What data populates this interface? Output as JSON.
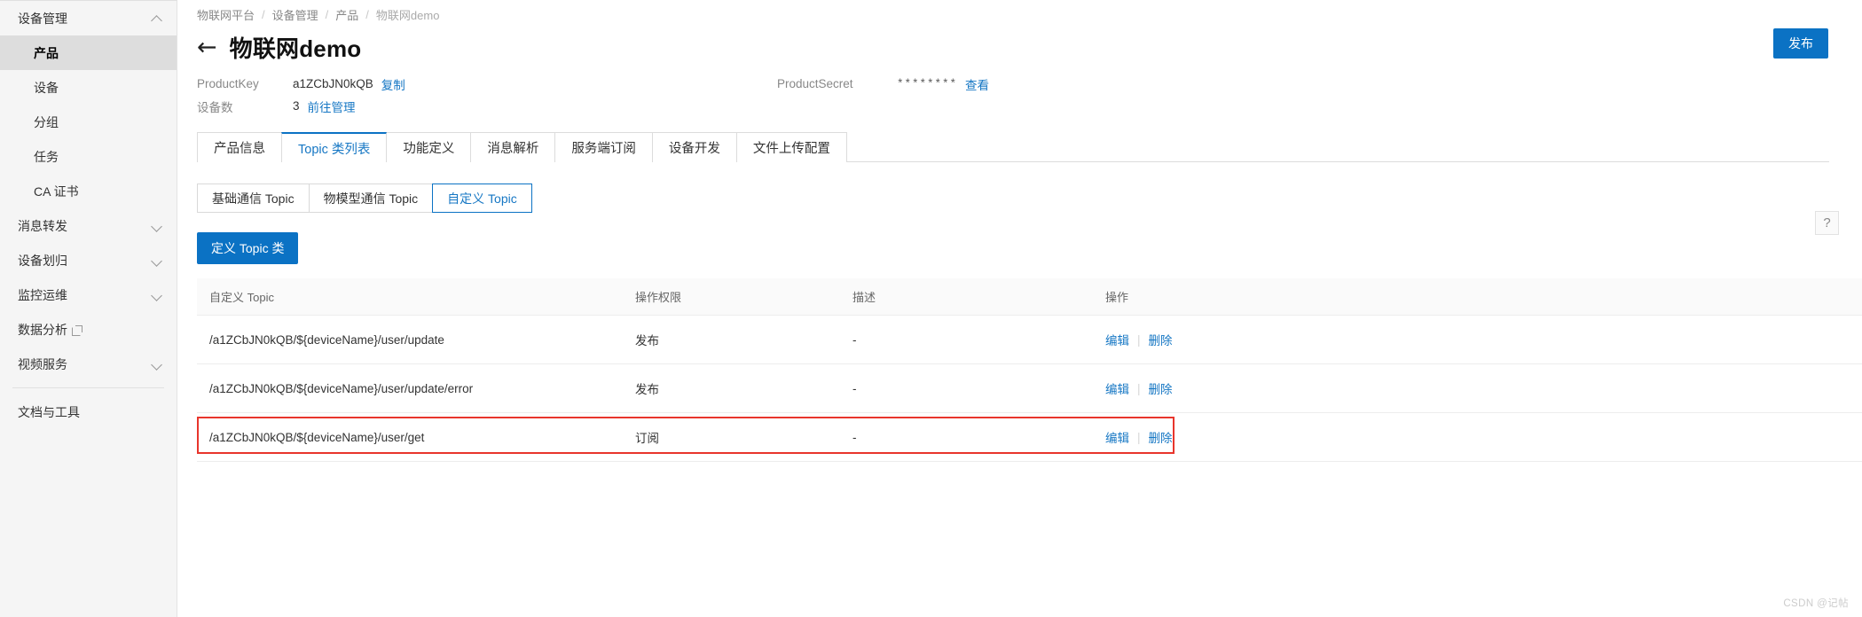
{
  "sidebar": {
    "groups": [
      {
        "label": "设备管理",
        "icon": "chevron-up-icon",
        "expanded": true,
        "items": [
          {
            "label": "产品",
            "active": true
          },
          {
            "label": "设备",
            "active": false
          },
          {
            "label": "分组",
            "active": false
          },
          {
            "label": "任务",
            "active": false
          },
          {
            "label": "CA 证书",
            "active": false
          }
        ]
      },
      {
        "label": "消息转发",
        "icon": "chevron-down-icon",
        "expanded": false,
        "items": []
      },
      {
        "label": "设备划归",
        "icon": "chevron-down-icon",
        "expanded": false,
        "items": []
      },
      {
        "label": "监控运维",
        "icon": "chevron-down-icon",
        "expanded": false,
        "items": []
      },
      {
        "label": "数据分析",
        "icon": "external-link-icon",
        "expanded": false,
        "items": []
      },
      {
        "label": "视频服务",
        "icon": "chevron-down-icon",
        "expanded": false,
        "items": []
      }
    ],
    "footer_label": "文档与工具"
  },
  "breadcrumb": {
    "items": [
      "物联网平台",
      "设备管理",
      "产品",
      "物联网demo"
    ],
    "separator": "/"
  },
  "header": {
    "back_icon": "arrow-left-icon",
    "title": "物联网demo",
    "publish_label": "发布"
  },
  "meta": {
    "product_key_label": "ProductKey",
    "product_key_value": "a1ZCbJN0kQB",
    "product_key_action": "复制",
    "device_count_label": "设备数",
    "device_count_value": "3",
    "device_count_action": "前往管理",
    "product_secret_label": "ProductSecret",
    "product_secret_value": "********",
    "product_secret_action": "查看"
  },
  "tabs": [
    {
      "label": "产品信息",
      "active": false
    },
    {
      "label": "Topic 类列表",
      "active": true
    },
    {
      "label": "功能定义",
      "active": false
    },
    {
      "label": "消息解析",
      "active": false
    },
    {
      "label": "服务端订阅",
      "active": false
    },
    {
      "label": "设备开发",
      "active": false
    },
    {
      "label": "文件上传配置",
      "active": false
    }
  ],
  "subtabs": [
    {
      "label": "基础通信 Topic",
      "active": false
    },
    {
      "label": "物模型通信 Topic",
      "active": false
    },
    {
      "label": "自定义 Topic",
      "active": true
    }
  ],
  "toolbar": {
    "define_topic_label": "定义 Topic 类",
    "help_label": "?"
  },
  "table": {
    "headers": [
      "自定义 Topic",
      "操作权限",
      "描述",
      "操作"
    ],
    "rows": [
      {
        "topic": "/a1ZCbJN0kQB/${deviceName}/user/update",
        "permission": "发布",
        "description": "-",
        "edit": "编辑",
        "delete": "删除",
        "highlighted": false
      },
      {
        "topic": "/a1ZCbJN0kQB/${deviceName}/user/update/error",
        "permission": "发布",
        "description": "-",
        "edit": "编辑",
        "delete": "删除",
        "highlighted": false
      },
      {
        "topic": "/a1ZCbJN0kQB/${deviceName}/user/get",
        "permission": "订阅",
        "description": "-",
        "edit": "编辑",
        "delete": "删除",
        "highlighted": true
      }
    ]
  },
  "watermark": "CSDN @记帖",
  "colors": {
    "accent": "#0b72c4",
    "link": "#1677c4",
    "highlight": "#e8352c",
    "sidebar_bg": "#f5f5f5",
    "active_item_bg": "#dddddd"
  }
}
